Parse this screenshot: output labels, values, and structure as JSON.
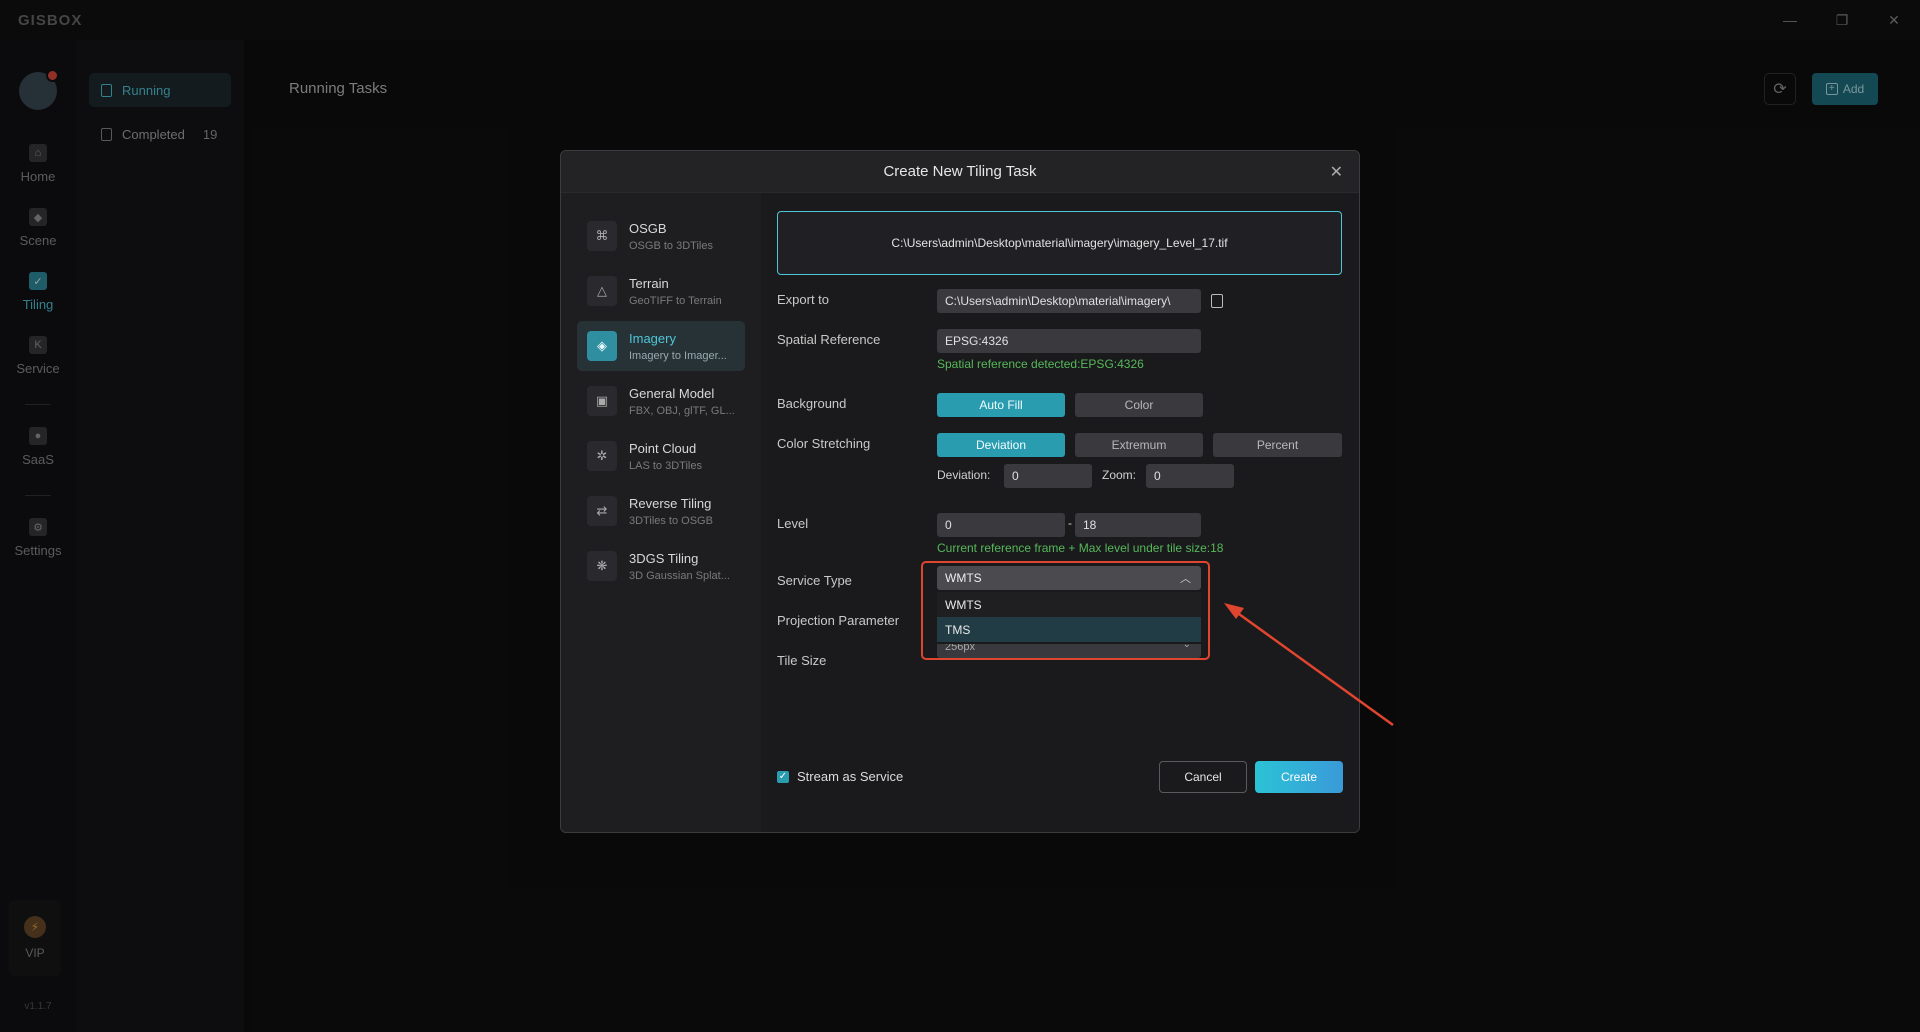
{
  "app": {
    "logo": "GISBOX",
    "version": "v1.1.7"
  },
  "window_controls": {
    "minimize": "—",
    "restore": "❐",
    "close": "✕"
  },
  "rail": {
    "items": [
      {
        "label": "Home",
        "icon": "home-icon"
      },
      {
        "label": "Scene",
        "icon": "scene-icon"
      },
      {
        "label": "Tiling",
        "icon": "tiling-icon",
        "active": true
      },
      {
        "label": "Service",
        "icon": "service-icon"
      },
      {
        "label": "SaaS",
        "icon": "saas-icon"
      },
      {
        "label": "Settings",
        "icon": "settings-icon"
      }
    ],
    "vip_label": "VIP"
  },
  "subnav": {
    "items": [
      {
        "label": "Running",
        "active": true,
        "count": ""
      },
      {
        "label": "Completed",
        "active": false,
        "count": "19"
      }
    ]
  },
  "main": {
    "title": "Running Tasks",
    "add_label": "Add"
  },
  "modal": {
    "title": "Create New Tiling Task",
    "types": [
      {
        "title": "OSGB",
        "subtitle": "OSGB to 3DTiles",
        "icon": "osgb-icon"
      },
      {
        "title": "Terrain",
        "subtitle": "GeoTIFF to Terrain",
        "icon": "terrain-icon"
      },
      {
        "title": "Imagery",
        "subtitle": "Imagery to Imager...",
        "icon": "imagery-icon",
        "active": true
      },
      {
        "title": "General Model",
        "subtitle": "FBX, OBJ, glTF, GL...",
        "icon": "model-icon"
      },
      {
        "title": "Point Cloud",
        "subtitle": "LAS to 3DTiles",
        "icon": "point-cloud-icon"
      },
      {
        "title": "Reverse Tiling",
        "subtitle": "3DTiles to OSGB",
        "icon": "reverse-tiling-icon"
      },
      {
        "title": "3DGS Tiling",
        "subtitle": "3D Gaussian Splat...",
        "icon": "gaussian-icon"
      }
    ],
    "file_path": "C:\\Users\\admin\\Desktop\\material\\imagery\\imagery_Level_17.tif",
    "export_label": "Export to",
    "export_value": "C:\\Users\\admin\\Desktop\\material\\imagery\\",
    "spatial_label": "Spatial Reference",
    "spatial_value": "EPSG:4326",
    "spatial_hint": "Spatial reference detected:EPSG:4326",
    "background_label": "Background",
    "background_options": [
      "Auto Fill",
      "Color"
    ],
    "stretch_label": "Color Stretching",
    "stretch_options": [
      "Deviation",
      "Extremum",
      "Percent"
    ],
    "deviation_label": "Deviation:",
    "deviation_value": "0",
    "zoom_label": "Zoom:",
    "zoom_value": "0",
    "level_label": "Level",
    "level_min": "0",
    "level_sep": "-",
    "level_max": "18",
    "level_hint": "Current reference frame + Max level under tile size:18",
    "service_label": "Service Type",
    "service_value": "WMTS",
    "service_options": [
      "WMTS",
      "TMS"
    ],
    "projection_label": "Projection Parameter",
    "tile_label": "Tile Size",
    "tile_value": "256px",
    "stream_label": "Stream as Service",
    "cancel_label": "Cancel",
    "create_label": "Create"
  },
  "colors": {
    "accent": "#2a9cb0",
    "highlight": "#e0452f",
    "hint": "#56b85a"
  }
}
